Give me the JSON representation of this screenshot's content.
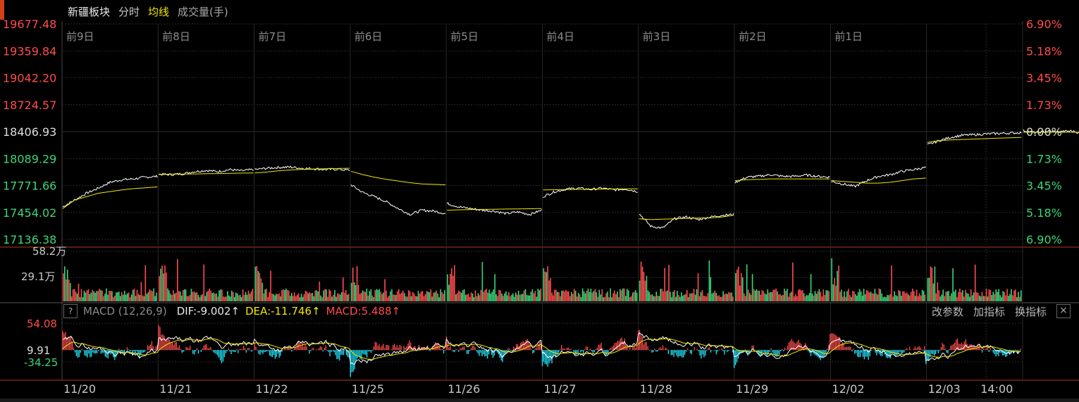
{
  "toolbar": {
    "sector": "新疆板块",
    "intraday": "分时",
    "avg_line": "均线",
    "volume": "成交量(手)"
  },
  "colors": {
    "background": "#000000",
    "grid": "#2a2a2a",
    "price_line": "#ffffff",
    "avg_line": "#f2e800",
    "up": "#ff4c4c",
    "down": "#3ad67a",
    "macd_neg": "#22e8ff"
  },
  "chart_data": [
    {
      "type": "line",
      "title": "",
      "price_ticks": [
        "19677.48",
        "19359.84",
        "19042.20",
        "18724.57",
        "18406.93",
        "18089.29",
        "17771.66",
        "17454.02",
        "17136.38"
      ],
      "pct_ticks": [
        "6.90%",
        "5.18%",
        "3.45%",
        "1.73%",
        "0.00%",
        "1.73%",
        "3.45%",
        "5.18%",
        "6.90%"
      ],
      "ylim": [
        17136.38,
        19677.48
      ],
      "baseline": 18406.93,
      "day_labels": [
        "前9日",
        "前8日",
        "前7日",
        "前6日",
        "前5日",
        "前4日",
        "前3日",
        "前2日",
        "前1日"
      ],
      "date_labels": [
        "11/20",
        "11/21",
        "11/22",
        "11/25",
        "11/26",
        "11/27",
        "11/28",
        "11/29",
        "12/02",
        "12/03",
        "14:00"
      ],
      "series": [
        {
          "values_per_day": [
            [
              17520,
              17600,
              17680,
              17740,
              17810,
              17840,
              17850,
              17870,
              17880
            ],
            [
              17905,
              17900,
              17910,
              17935,
              17950,
              17935,
              17960,
              17945,
              17960
            ],
            [
              17960,
              17975,
              17985,
              17990,
              17975,
              17970,
              17960,
              17965,
              17950
            ],
            [
              17780,
              17690,
              17640,
              17580,
              17500,
              17430,
              17480,
              17470,
              17440
            ],
            [
              17560,
              17520,
              17500,
              17480,
              17470,
              17440,
              17460,
              17430,
              17480
            ],
            [
              17640,
              17700,
              17730,
              17740,
              17725,
              17740,
              17720,
              17730,
              17700
            ],
            [
              17440,
              17290,
              17270,
              17380,
              17400,
              17370,
              17400,
              17420,
              17430
            ],
            [
              17810,
              17870,
              17880,
              17900,
              17880,
              17880,
              17895,
              17880,
              17870
            ],
            [
              17820,
              17790,
              17760,
              17830,
              17880,
              17900,
              17940,
              17960,
              17985
            ],
            [
              18250,
              18300,
              18340,
              18365,
              18370,
              18380,
              18385,
              18390,
              18395
            ],
            [
              18420,
              18395,
              18410,
              18405,
              18415,
              18390,
              18405,
              18430,
              18410
            ]
          ]
        },
        {
          "avg_per_day": [
            [
              17500,
              17600,
              17640,
              17680,
              17700,
              17720,
              17735,
              17745,
              17755
            ],
            [
              17900,
              17905,
              17906,
              17908,
              17910,
              17912,
              17915,
              17918,
              17920
            ],
            [
              17920,
              17930,
              17945,
              17955,
              17962,
              17966,
              17970,
              17972,
              17975
            ],
            [
              17940,
              17900,
              17870,
              17845,
              17825,
              17805,
              17790,
              17785,
              17780
            ],
            [
              17480,
              17485,
              17487,
              17490,
              17492,
              17494,
              17496,
              17498,
              17500
            ],
            [
              17720,
              17722,
              17724,
              17726,
              17728,
              17730,
              17731,
              17732,
              17733
            ],
            [
              17380,
              17370,
              17375,
              17380,
              17385,
              17388,
              17390,
              17400,
              17420
            ],
            [
              17830,
              17840,
              17845,
              17850,
              17850,
              17850,
              17850,
              17850,
              17850
            ],
            [
              17830,
              17820,
              17810,
              17800,
              17800,
              17810,
              17830,
              17850,
              17860
            ],
            [
              18280,
              18300,
              18310,
              18315,
              18320,
              18325,
              18330,
              18335,
              18340
            ],
            [
              18400,
              18400,
              18400,
              18400,
              18400,
              18400,
              18400,
              18400,
              18400
            ]
          ]
        }
      ]
    },
    {
      "type": "bar",
      "title": "",
      "y_ticks": [
        "58.2万",
        "29.1万"
      ],
      "ylim": [
        0,
        582000
      ]
    },
    {
      "type": "line",
      "title": "",
      "y_ticks": [
        "54.08",
        "9.91",
        "-34.25"
      ],
      "ylim": [
        -55,
        60
      ],
      "baseline": 9.91,
      "indicator": "MACD (12,26,9)",
      "dif": "DIF:-9.002",
      "dea": "DEA:-11.746",
      "macd": "MACD:5.488",
      "dif_arrow": "↑",
      "dea_arrow": "↑",
      "macd_arrow": "↑"
    }
  ],
  "macd_panel": {
    "help": "?",
    "name": "MACD (12,26,9)",
    "dif": "DIF:-9.002↑",
    "dea": "DEA:-11.746↑",
    "macd": "MACD:5.488↑",
    "change_params": "改参数",
    "add_indicator": "加指标",
    "switch_indicator": "换指标",
    "close": "×"
  }
}
